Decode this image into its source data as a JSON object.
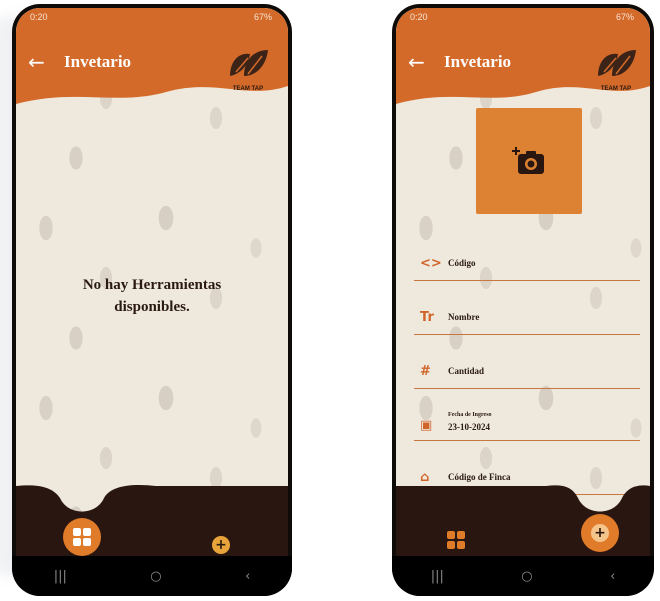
{
  "status": {
    "left_time": "0:20",
    "right_time": "0:20",
    "battery": "67%"
  },
  "app": {
    "title": "Invetario",
    "logo_text": "TEAM TAP",
    "back_icon": "back-arrow-icon"
  },
  "left_screen": {
    "empty_message_line1": "No hay Herramientas",
    "empty_message_line2": "disponibles."
  },
  "right_screen": {
    "photo_icon": "add-photo-icon",
    "fields": [
      {
        "icon": "code-icon",
        "glyph": "<>",
        "label": "Código"
      },
      {
        "icon": "text-icon",
        "glyph": "Tr",
        "label": "Nombre"
      },
      {
        "icon": "hash-icon",
        "glyph": "#",
        "label": "Cantidad"
      },
      {
        "icon": "calendar-icon",
        "glyph": "▣",
        "label": "Fecha de Ingreso",
        "value": "23-10-2024"
      },
      {
        "icon": "home-icon",
        "glyph": "⌂",
        "label": "Código de Finca"
      }
    ]
  },
  "colors": {
    "header": "#d46a2a",
    "accent": "#e07b2a",
    "bottom_bar": "#2a1610",
    "background": "#efe8dd"
  },
  "navbar": {
    "recent": "|||",
    "home": "○",
    "back": "‹"
  }
}
